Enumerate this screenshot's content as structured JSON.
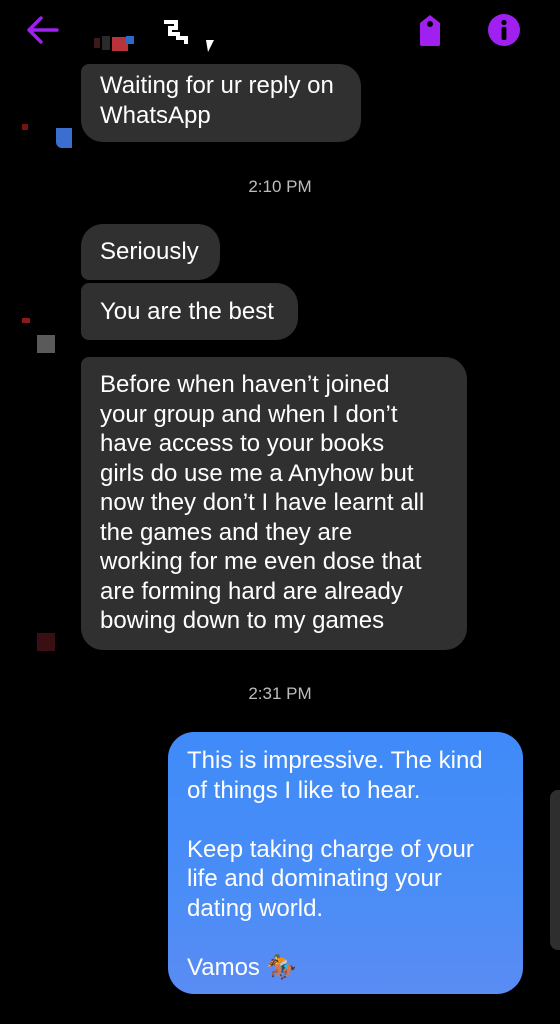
{
  "header": {
    "back_icon": "arrow-left-icon",
    "tag_icon": "tag-icon",
    "info_icon": "info-icon",
    "accent": "#a020f0"
  },
  "messages": {
    "m1": {
      "line1": "Waiting for ur reply on",
      "line2": "WhatsApp"
    },
    "ts1": "2:10 PM",
    "m2": "Seriously",
    "m3": "You are the best",
    "m4": [
      "Before when haven’t joined",
      "your group and when I don’t",
      "have access to your books",
      "girls do use me a Anyhow but",
      "now they don’t I have learnt all",
      "the games and they are",
      "working for me even dose that",
      "are forming hard are already",
      "bowing down to my games"
    ],
    "ts2": "2:31 PM",
    "out": {
      "p1l1": "This is impressive. The kind",
      "p1l2": "of things I like to hear.",
      "p2l1": "Keep taking charge of your",
      "p2l2": "life and dominating your",
      "p2l3": "dating world.",
      "p3": "Vamos 🏇"
    }
  },
  "colors": {
    "incoming_bubble": "#303030",
    "outgoing_bubble": "#4a8df7",
    "background": "#000000"
  }
}
